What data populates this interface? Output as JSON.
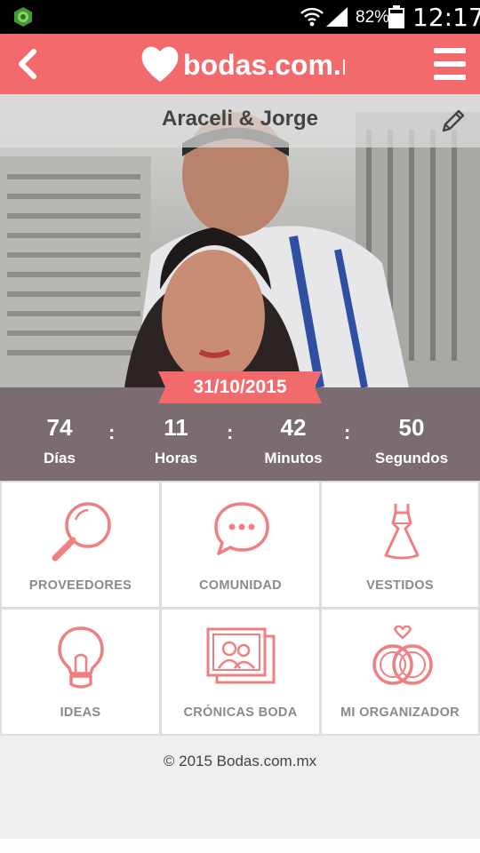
{
  "status_bar": {
    "battery_percent": "82%",
    "time": "12:17",
    "icons": [
      "app-notification-icon",
      "wifi-icon",
      "signal-icon",
      "battery-icon"
    ]
  },
  "app_bar": {
    "logo_text": "bodas.com.mx",
    "back_icon": "chevron-left-icon",
    "menu_icon": "hamburger-menu-icon",
    "color": "#f36a6c"
  },
  "profile": {
    "couple_name": "Araceli & Jorge",
    "edit_icon": "pencil-icon",
    "wedding_date": "31/10/2015"
  },
  "countdown": {
    "separator": ":",
    "items": [
      {
        "value": "74",
        "unit": "Días"
      },
      {
        "value": "11",
        "unit": "Horas"
      },
      {
        "value": "42",
        "unit": "Minutos"
      },
      {
        "value": "50",
        "unit": "Segundos"
      }
    ],
    "color": "#7b6c72"
  },
  "menu_tiles": [
    {
      "label": "PROVEEDORES",
      "icon": "magnifier-icon"
    },
    {
      "label": "COMUNIDAD",
      "icon": "chat-bubble-icon"
    },
    {
      "label": "VESTIDOS",
      "icon": "dress-icon"
    },
    {
      "label": "IDEAS",
      "icon": "lightbulb-icon"
    },
    {
      "label": "CRÓNICAS BODA",
      "icon": "photos-icon"
    },
    {
      "label": "MI ORGANIZADOR",
      "icon": "rings-icon"
    }
  ],
  "footer": {
    "copyright": "© 2015 Bodas.com.mx"
  },
  "accent_color": "#f36a6c",
  "icon_color": "#ef7f80"
}
